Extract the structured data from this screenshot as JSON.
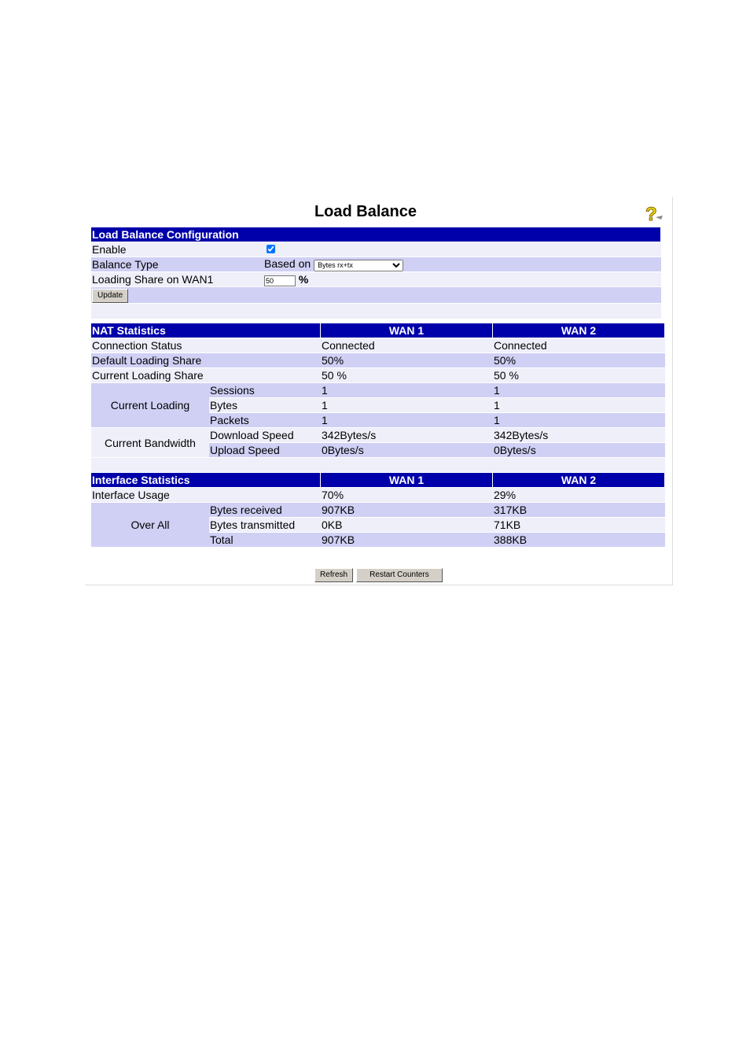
{
  "page": {
    "title": "Load Balance",
    "help_icon": "help-question-icon"
  },
  "config": {
    "header": "Load Balance Configuration",
    "enable_label": "Enable",
    "enable_checked": true,
    "balance_type_label": "Balance Type",
    "based_on": "Based on",
    "balance_type_value": "Bytes rx+tx",
    "loading_share_label": "Loading Share on WAN1",
    "loading_share_value": "50",
    "percent": "%",
    "update_button": "Update"
  },
  "nat": {
    "header": "NAT Statistics",
    "wan1": "WAN 1",
    "wan2": "WAN 2",
    "connection_status": {
      "label": "Connection Status",
      "wan1": "Connected",
      "wan2": "Connected"
    },
    "default_share": {
      "label": "Default Loading Share",
      "wan1": "50%",
      "wan2": "50%"
    },
    "current_share": {
      "label": "Current Loading Share",
      "wan1": "50 %",
      "wan2": "50 %"
    },
    "current_loading": {
      "label": "Current Loading",
      "rows": [
        {
          "label": "Sessions",
          "wan1": "1",
          "wan2": "1"
        },
        {
          "label": "Bytes",
          "wan1": "1",
          "wan2": "1"
        },
        {
          "label": "Packets",
          "wan1": "1",
          "wan2": "1"
        }
      ]
    },
    "current_bandwidth": {
      "label": "Current Bandwidth",
      "rows": [
        {
          "label": "Download Speed",
          "wan1": "342Bytes/s",
          "wan2": "342Bytes/s"
        },
        {
          "label": "Upload Speed",
          "wan1": "0Bytes/s",
          "wan2": "0Bytes/s"
        }
      ]
    }
  },
  "iface": {
    "header": "Interface Statistics",
    "wan1": "WAN 1",
    "wan2": "WAN 2",
    "usage": {
      "label": "Interface Usage",
      "wan1": "70%",
      "wan2": "29%"
    },
    "overall": {
      "label": "Over All",
      "rows": [
        {
          "label": "Bytes received",
          "wan1": "907KB",
          "wan2": "317KB"
        },
        {
          "label": "Bytes transmitted",
          "wan1": "0KB",
          "wan2": "71KB"
        },
        {
          "label": "Total",
          "wan1": "907KB",
          "wan2": "388KB"
        }
      ]
    }
  },
  "buttons": {
    "refresh": "Refresh",
    "restart": "Restart Counters"
  },
  "colors": {
    "header": "#0000aa",
    "row_light": "#efeffa",
    "row_dark": "#d0d0f5"
  }
}
